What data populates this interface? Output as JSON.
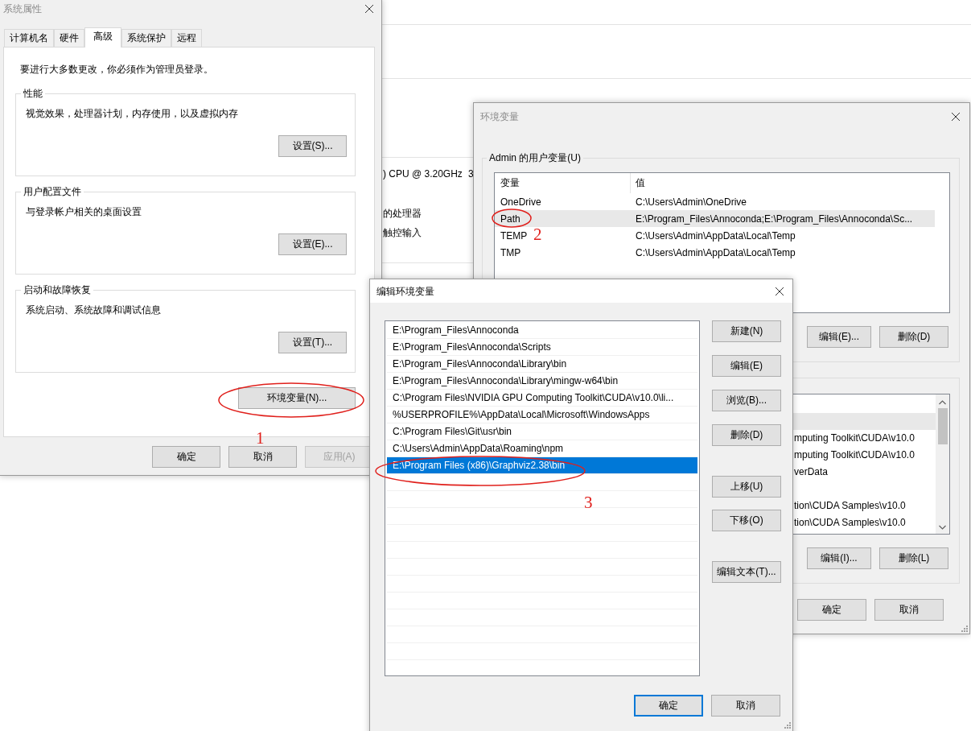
{
  "background_window": {
    "texts": [
      {
        "text": ") CPU @ 3.20GHz"
      },
      {
        "text": "3"
      },
      {
        "text": "的处理器"
      },
      {
        "text": "触控输入"
      }
    ]
  },
  "system_properties": {
    "title": "系统属性",
    "active": false,
    "tabs": [
      {
        "label": "计算机名",
        "selected": false
      },
      {
        "label": "硬件",
        "selected": false
      },
      {
        "label": "高级",
        "selected": true
      },
      {
        "label": "系统保护",
        "selected": false
      },
      {
        "label": "远程",
        "selected": false
      }
    ],
    "notice": "要进行大多数更改，你必须作为管理员登录。",
    "groups": [
      {
        "title": "性能",
        "description": "视觉效果，处理器计划，内存使用，以及虚拟内存",
        "button": "设置(S)..."
      },
      {
        "title": "用户配置文件",
        "description": "与登录帐户相关的桌面设置",
        "button": "设置(E)..."
      },
      {
        "title": "启动和故障恢复",
        "description": "系统启动、系统故障和调试信息",
        "button": "设置(T)..."
      }
    ],
    "env_button": "环境变量(N)...",
    "buttons": [
      {
        "label": "确定",
        "disabled": false
      },
      {
        "label": "取消",
        "disabled": false
      },
      {
        "label": "应用(A)",
        "disabled": true
      }
    ]
  },
  "environment_variables": {
    "title": "环境变量",
    "active": false,
    "user_group": "Admin 的用户变量(U)",
    "columns": [
      "变量",
      "值"
    ],
    "user_rows": [
      {
        "name": "OneDrive",
        "value": "C:\\Users\\Admin\\OneDrive",
        "selected": false
      },
      {
        "name": "Path",
        "value": "E:\\Program_Files\\Annoconda;E:\\Program_Files\\Annoconda\\Sc...",
        "selected": true
      },
      {
        "name": "TEMP",
        "value": "C:\\Users\\Admin\\AppData\\Local\\Temp",
        "selected": false
      },
      {
        "name": "TMP",
        "value": "C:\\Users\\Admin\\AppData\\Local\\Temp",
        "selected": false
      }
    ],
    "user_buttons": [
      "编辑(E)...",
      "删除(D)"
    ],
    "system_rows": [
      {
        "selected": true
      },
      {
        "value": "mputing Toolkit\\CUDA\\v10.0",
        "selected": false
      },
      {
        "value": "mputing Toolkit\\CUDA\\v10.0",
        "selected": false
      },
      {
        "value": "verData",
        "selected": false
      },
      {
        "selected": false
      },
      {
        "value": "tion\\CUDA Samples\\v10.0",
        "selected": false
      },
      {
        "value": "tion\\CUDA Samples\\v10.0",
        "selected": false
      }
    ],
    "system_buttons": [
      "编辑(I)...",
      "删除(L)"
    ],
    "buttons": [
      "确定",
      "取消"
    ]
  },
  "edit_dialog": {
    "title": "编辑环境变量",
    "active": true,
    "items": [
      {
        "text": "E:\\Program_Files\\Annoconda",
        "selected": false
      },
      {
        "text": "E:\\Program_Files\\Annoconda\\Scripts",
        "selected": false
      },
      {
        "text": "E:\\Program_Files\\Annoconda\\Library\\bin",
        "selected": false
      },
      {
        "text": "E:\\Program_Files\\Annoconda\\Library\\mingw-w64\\bin",
        "selected": false
      },
      {
        "text": "C:\\Program Files\\NVIDIA GPU Computing Toolkit\\CUDA\\v10.0\\li...",
        "selected": false
      },
      {
        "text": "%USERPROFILE%\\AppData\\Local\\Microsoft\\WindowsApps",
        "selected": false
      },
      {
        "text": "C:\\Program Files\\Git\\usr\\bin",
        "selected": false
      },
      {
        "text": "C:\\Users\\Admin\\AppData\\Roaming\\npm",
        "selected": false
      },
      {
        "text": "E:\\Program Files (x86)\\Graphviz2.38\\bin",
        "selected": true
      }
    ],
    "side_buttons": [
      "新建(N)",
      "编辑(E)",
      "浏览(B)...",
      "删除(D)",
      "上移(U)",
      "下移(O)",
      "编辑文本(T)..."
    ],
    "buttons": [
      {
        "label": "确定",
        "default": true
      },
      {
        "label": "取消",
        "default": false
      }
    ]
  },
  "annotations": [
    {
      "label": "1"
    },
    {
      "label": "2"
    },
    {
      "label": "3"
    }
  ]
}
